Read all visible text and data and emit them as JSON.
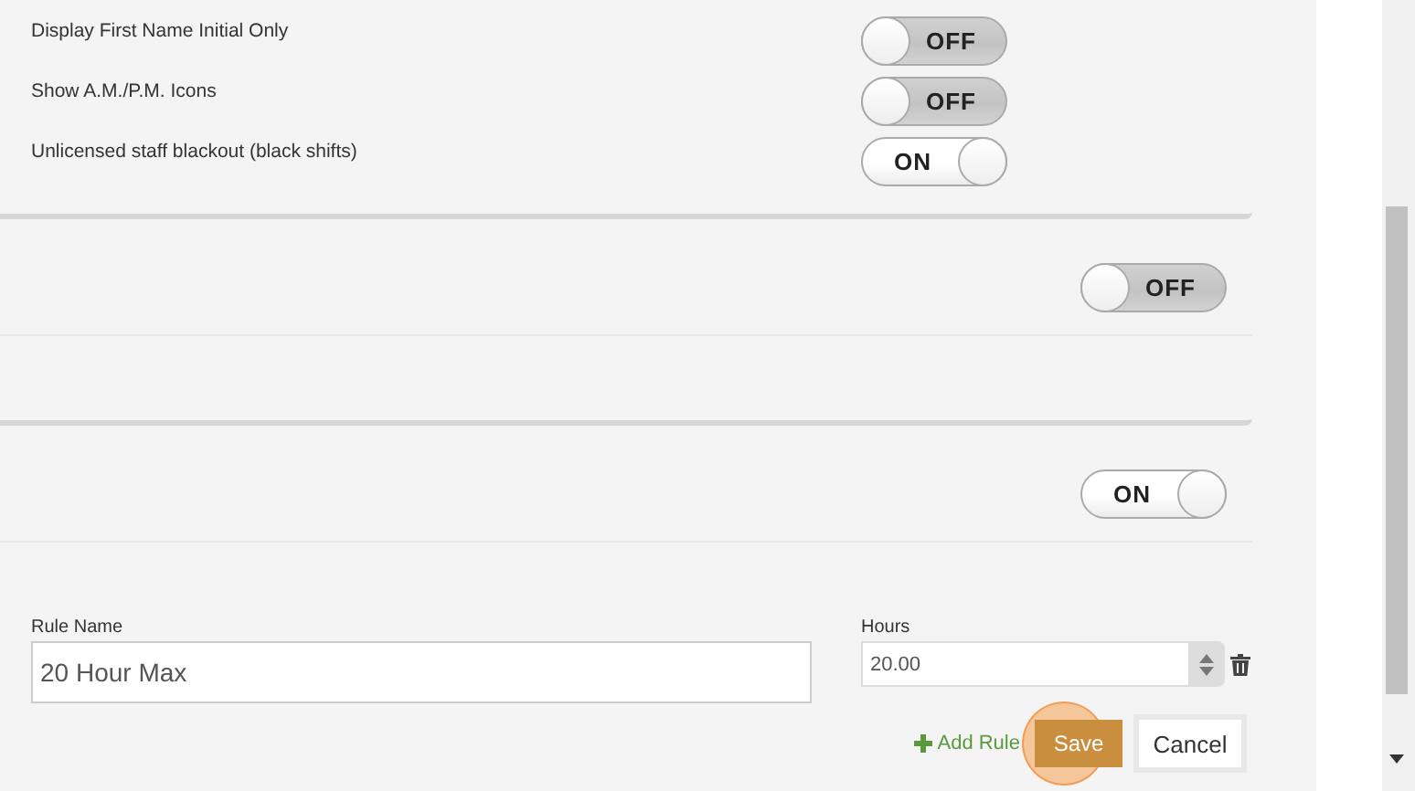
{
  "settings": [
    {
      "label": "Display First Name Initial Only",
      "on": false,
      "text": "OFF"
    },
    {
      "label": "Show A.M./P.M. Icons",
      "on": false,
      "text": "OFF"
    },
    {
      "label": "Unlicensed staff blackout (black shifts)",
      "on": true,
      "text": "ON"
    }
  ],
  "sections": [
    {
      "on": false,
      "text": "OFF"
    },
    {
      "on": true,
      "text": "ON"
    }
  ],
  "rule_form": {
    "rule_name_label": "Rule Name",
    "rule_name_value": "20 Hour Max",
    "hours_label": "Hours",
    "hours_value": "20.00",
    "add_rule": "Add Rule",
    "save": "Save",
    "cancel": "Cancel"
  }
}
